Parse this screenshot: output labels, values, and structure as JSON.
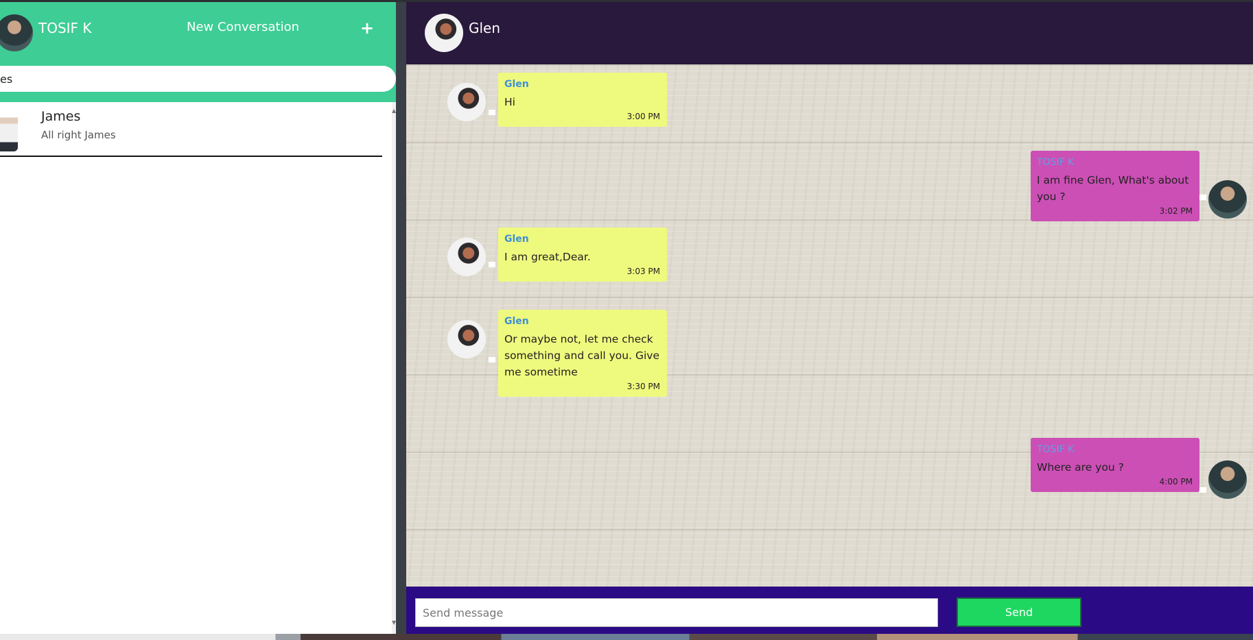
{
  "sidebar": {
    "user_name": "TOSIF K",
    "new_conversation_label": "New Conversation",
    "add_icon_glyph": "+",
    "search_value": "es",
    "conversations": [
      {
        "name": "James",
        "preview": "All right James"
      }
    ]
  },
  "chat": {
    "contact_name": "Glen",
    "messages": [
      {
        "direction": "in",
        "sender": "Glen",
        "text": "Hi",
        "time": "3:00 PM"
      },
      {
        "direction": "out",
        "sender": "TOSIF K",
        "text": "I am fine Glen, What's about you ?",
        "time": "3:02 PM"
      },
      {
        "direction": "in",
        "sender": "Glen",
        "text": "I am great,Dear.",
        "time": "3:03 PM"
      },
      {
        "direction": "in",
        "sender": "Glen",
        "text": "Or maybe not, let me check something and call you. Give me sometime",
        "time": "3:30 PM"
      },
      {
        "direction": "out",
        "sender": "TOSIF K",
        "text": "Where are you ?",
        "time": "4:00 PM"
      }
    ],
    "composer": {
      "placeholder": "Send message",
      "send_label": "Send"
    }
  },
  "colors": {
    "sidebar_header": "#3ecd95",
    "chat_header": "#28193d",
    "incoming_bubble": "#eefa7e",
    "outgoing_bubble": "#cc4fb5",
    "composer_bar": "#2b0a85",
    "send_button": "#1ed760"
  },
  "icons": {
    "add": "plus-icon",
    "scroll_up": "scroll-up-arrow-icon",
    "scroll_down": "scroll-down-arrow-icon"
  }
}
